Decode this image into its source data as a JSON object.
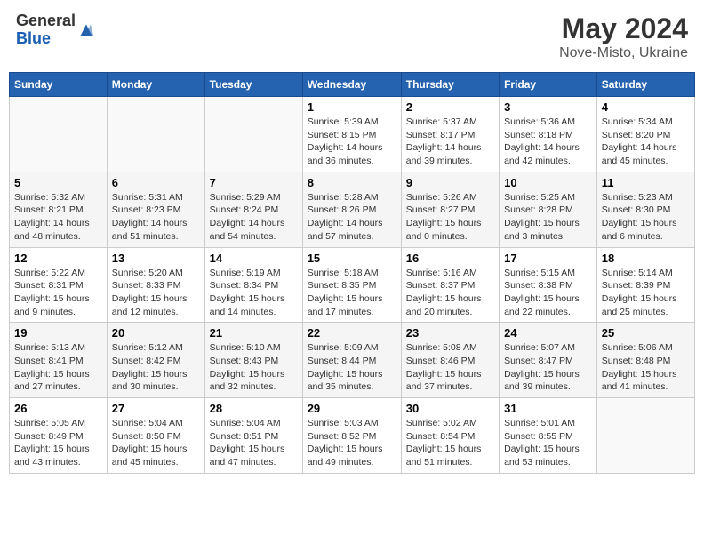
{
  "header": {
    "logo_general": "General",
    "logo_blue": "Blue",
    "month_title": "May 2024",
    "location": "Nove-Misto, Ukraine"
  },
  "weekdays": [
    "Sunday",
    "Monday",
    "Tuesday",
    "Wednesday",
    "Thursday",
    "Friday",
    "Saturday"
  ],
  "weeks": [
    [
      {
        "day": "",
        "info": ""
      },
      {
        "day": "",
        "info": ""
      },
      {
        "day": "",
        "info": ""
      },
      {
        "day": "1",
        "info": "Sunrise: 5:39 AM\nSunset: 8:15 PM\nDaylight: 14 hours\nand 36 minutes."
      },
      {
        "day": "2",
        "info": "Sunrise: 5:37 AM\nSunset: 8:17 PM\nDaylight: 14 hours\nand 39 minutes."
      },
      {
        "day": "3",
        "info": "Sunrise: 5:36 AM\nSunset: 8:18 PM\nDaylight: 14 hours\nand 42 minutes."
      },
      {
        "day": "4",
        "info": "Sunrise: 5:34 AM\nSunset: 8:20 PM\nDaylight: 14 hours\nand 45 minutes."
      }
    ],
    [
      {
        "day": "5",
        "info": "Sunrise: 5:32 AM\nSunset: 8:21 PM\nDaylight: 14 hours\nand 48 minutes."
      },
      {
        "day": "6",
        "info": "Sunrise: 5:31 AM\nSunset: 8:23 PM\nDaylight: 14 hours\nand 51 minutes."
      },
      {
        "day": "7",
        "info": "Sunrise: 5:29 AM\nSunset: 8:24 PM\nDaylight: 14 hours\nand 54 minutes."
      },
      {
        "day": "8",
        "info": "Sunrise: 5:28 AM\nSunset: 8:26 PM\nDaylight: 14 hours\nand 57 minutes."
      },
      {
        "day": "9",
        "info": "Sunrise: 5:26 AM\nSunset: 8:27 PM\nDaylight: 15 hours\nand 0 minutes."
      },
      {
        "day": "10",
        "info": "Sunrise: 5:25 AM\nSunset: 8:28 PM\nDaylight: 15 hours\nand 3 minutes."
      },
      {
        "day": "11",
        "info": "Sunrise: 5:23 AM\nSunset: 8:30 PM\nDaylight: 15 hours\nand 6 minutes."
      }
    ],
    [
      {
        "day": "12",
        "info": "Sunrise: 5:22 AM\nSunset: 8:31 PM\nDaylight: 15 hours\nand 9 minutes."
      },
      {
        "day": "13",
        "info": "Sunrise: 5:20 AM\nSunset: 8:33 PM\nDaylight: 15 hours\nand 12 minutes."
      },
      {
        "day": "14",
        "info": "Sunrise: 5:19 AM\nSunset: 8:34 PM\nDaylight: 15 hours\nand 14 minutes."
      },
      {
        "day": "15",
        "info": "Sunrise: 5:18 AM\nSunset: 8:35 PM\nDaylight: 15 hours\nand 17 minutes."
      },
      {
        "day": "16",
        "info": "Sunrise: 5:16 AM\nSunset: 8:37 PM\nDaylight: 15 hours\nand 20 minutes."
      },
      {
        "day": "17",
        "info": "Sunrise: 5:15 AM\nSunset: 8:38 PM\nDaylight: 15 hours\nand 22 minutes."
      },
      {
        "day": "18",
        "info": "Sunrise: 5:14 AM\nSunset: 8:39 PM\nDaylight: 15 hours\nand 25 minutes."
      }
    ],
    [
      {
        "day": "19",
        "info": "Sunrise: 5:13 AM\nSunset: 8:41 PM\nDaylight: 15 hours\nand 27 minutes."
      },
      {
        "day": "20",
        "info": "Sunrise: 5:12 AM\nSunset: 8:42 PM\nDaylight: 15 hours\nand 30 minutes."
      },
      {
        "day": "21",
        "info": "Sunrise: 5:10 AM\nSunset: 8:43 PM\nDaylight: 15 hours\nand 32 minutes."
      },
      {
        "day": "22",
        "info": "Sunrise: 5:09 AM\nSunset: 8:44 PM\nDaylight: 15 hours\nand 35 minutes."
      },
      {
        "day": "23",
        "info": "Sunrise: 5:08 AM\nSunset: 8:46 PM\nDaylight: 15 hours\nand 37 minutes."
      },
      {
        "day": "24",
        "info": "Sunrise: 5:07 AM\nSunset: 8:47 PM\nDaylight: 15 hours\nand 39 minutes."
      },
      {
        "day": "25",
        "info": "Sunrise: 5:06 AM\nSunset: 8:48 PM\nDaylight: 15 hours\nand 41 minutes."
      }
    ],
    [
      {
        "day": "26",
        "info": "Sunrise: 5:05 AM\nSunset: 8:49 PM\nDaylight: 15 hours\nand 43 minutes."
      },
      {
        "day": "27",
        "info": "Sunrise: 5:04 AM\nSunset: 8:50 PM\nDaylight: 15 hours\nand 45 minutes."
      },
      {
        "day": "28",
        "info": "Sunrise: 5:04 AM\nSunset: 8:51 PM\nDaylight: 15 hours\nand 47 minutes."
      },
      {
        "day": "29",
        "info": "Sunrise: 5:03 AM\nSunset: 8:52 PM\nDaylight: 15 hours\nand 49 minutes."
      },
      {
        "day": "30",
        "info": "Sunrise: 5:02 AM\nSunset: 8:54 PM\nDaylight: 15 hours\nand 51 minutes."
      },
      {
        "day": "31",
        "info": "Sunrise: 5:01 AM\nSunset: 8:55 PM\nDaylight: 15 hours\nand 53 minutes."
      },
      {
        "day": "",
        "info": ""
      }
    ]
  ]
}
